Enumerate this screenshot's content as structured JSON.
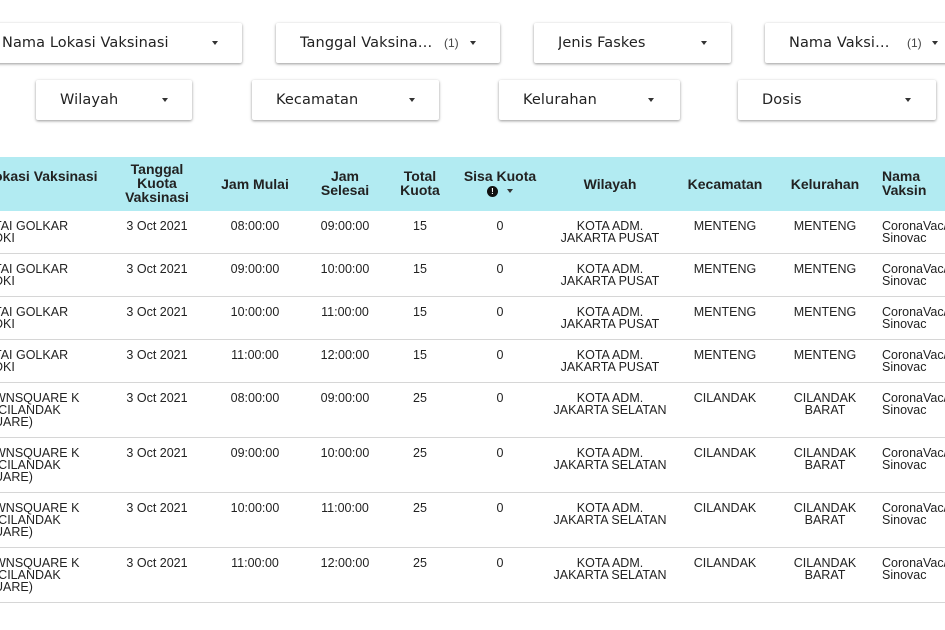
{
  "filters": {
    "nama_lokasi": {
      "label": "Nama Lokasi Vaksinasi"
    },
    "tanggal": {
      "label": "Tanggal Vaksinasi: ...",
      "count": "(1)"
    },
    "jenis_faskes": {
      "label": "Jenis Faskes"
    },
    "nama_vaksin": {
      "label": "Nama Vaksin: ...",
      "count": "(1)"
    },
    "wilayah": {
      "label": "Wilayah"
    },
    "kecamatan": {
      "label": "Kecamatan"
    },
    "kelurahan": {
      "label": "Kelurahan"
    },
    "dosis": {
      "label": "Dosis"
    }
  },
  "table": {
    "headers": {
      "lokasi": "okasi Vaksinasi",
      "tanggal": "Tanggal Kuota Vaksinasi",
      "jam_mulai": "Jam Mulai",
      "jam_selesai": "Jam Selesai",
      "total_kuota": "Total Kuota",
      "sisa_kuota": "Sisa Kuota",
      "sisa_info": "!",
      "wilayah": "Wilayah",
      "kecamatan": "Kecamatan",
      "kelurahan": "Kelurahan",
      "vaksin": "Nama Vaksin"
    },
    "rows": [
      {
        "lokasi": "TAI GOLKAR DKI",
        "tanggal": "3 Oct 2021",
        "jam_mulai": "08:00:00",
        "jam_selesai": "09:00:00",
        "total": "15",
        "sisa": "0",
        "wilayah": "KOTA ADM. JAKARTA PUSAT",
        "kecamatan": "MENTENG",
        "kelurahan": "MENTENG",
        "vaksin": "CoronaVac/ Sinovac"
      },
      {
        "lokasi": "TAI GOLKAR DKI",
        "tanggal": "3 Oct 2021",
        "jam_mulai": "09:00:00",
        "jam_selesai": "10:00:00",
        "total": "15",
        "sisa": "0",
        "wilayah": "KOTA ADM. JAKARTA PUSAT",
        "kecamatan": "MENTENG",
        "kelurahan": "MENTENG",
        "vaksin": "CoronaVac/ Sinovac"
      },
      {
        "lokasi": "TAI GOLKAR DKI",
        "tanggal": "3 Oct 2021",
        "jam_mulai": "10:00:00",
        "jam_selesai": "11:00:00",
        "total": "15",
        "sisa": "0",
        "wilayah": "KOTA ADM. JAKARTA PUSAT",
        "kecamatan": "MENTENG",
        "kelurahan": "MENTENG",
        "vaksin": "CoronaVac/ Sinovac"
      },
      {
        "lokasi": "TAI GOLKAR DKI",
        "tanggal": "3 Oct 2021",
        "jam_mulai": "11:00:00",
        "jam_selesai": "12:00:00",
        "total": "15",
        "sisa": "0",
        "wilayah": "KOTA ADM. JAKARTA PUSAT",
        "kecamatan": "MENTENG",
        "kelurahan": "MENTENG",
        "vaksin": "CoronaVac/ Sinovac"
      },
      {
        "lokasi": "WNSQUARE K (CILANDAK UARE)",
        "tanggal": "3 Oct 2021",
        "jam_mulai": "08:00:00",
        "jam_selesai": "09:00:00",
        "total": "25",
        "sisa": "0",
        "wilayah": "KOTA ADM. JAKARTA SELATAN",
        "kecamatan": "CILANDAK",
        "kelurahan": "CILANDAK BARAT",
        "vaksin": "CoronaVac/ Sinovac"
      },
      {
        "lokasi": "WNSQUARE K (CILANDAK UARE)",
        "tanggal": "3 Oct 2021",
        "jam_mulai": "09:00:00",
        "jam_selesai": "10:00:00",
        "total": "25",
        "sisa": "0",
        "wilayah": "KOTA ADM. JAKARTA SELATAN",
        "kecamatan": "CILANDAK",
        "kelurahan": "CILANDAK BARAT",
        "vaksin": "CoronaVac/ Sinovac"
      },
      {
        "lokasi": "WNSQUARE K (CILANDAK UARE)",
        "tanggal": "3 Oct 2021",
        "jam_mulai": "10:00:00",
        "jam_selesai": "11:00:00",
        "total": "25",
        "sisa": "0",
        "wilayah": "KOTA ADM. JAKARTA SELATAN",
        "kecamatan": "CILANDAK",
        "kelurahan": "CILANDAK BARAT",
        "vaksin": "CoronaVac/ Sinovac"
      },
      {
        "lokasi": "WNSQUARE K (CILANDAK UARE)",
        "tanggal": "3 Oct 2021",
        "jam_mulai": "11:00:00",
        "jam_selesai": "12:00:00",
        "total": "25",
        "sisa": "0",
        "wilayah": "KOTA ADM. JAKARTA SELATAN",
        "kecamatan": "CILANDAK",
        "kelurahan": "CILANDAK BARAT",
        "vaksin": "CoronaVac/ Sinovac"
      }
    ]
  }
}
